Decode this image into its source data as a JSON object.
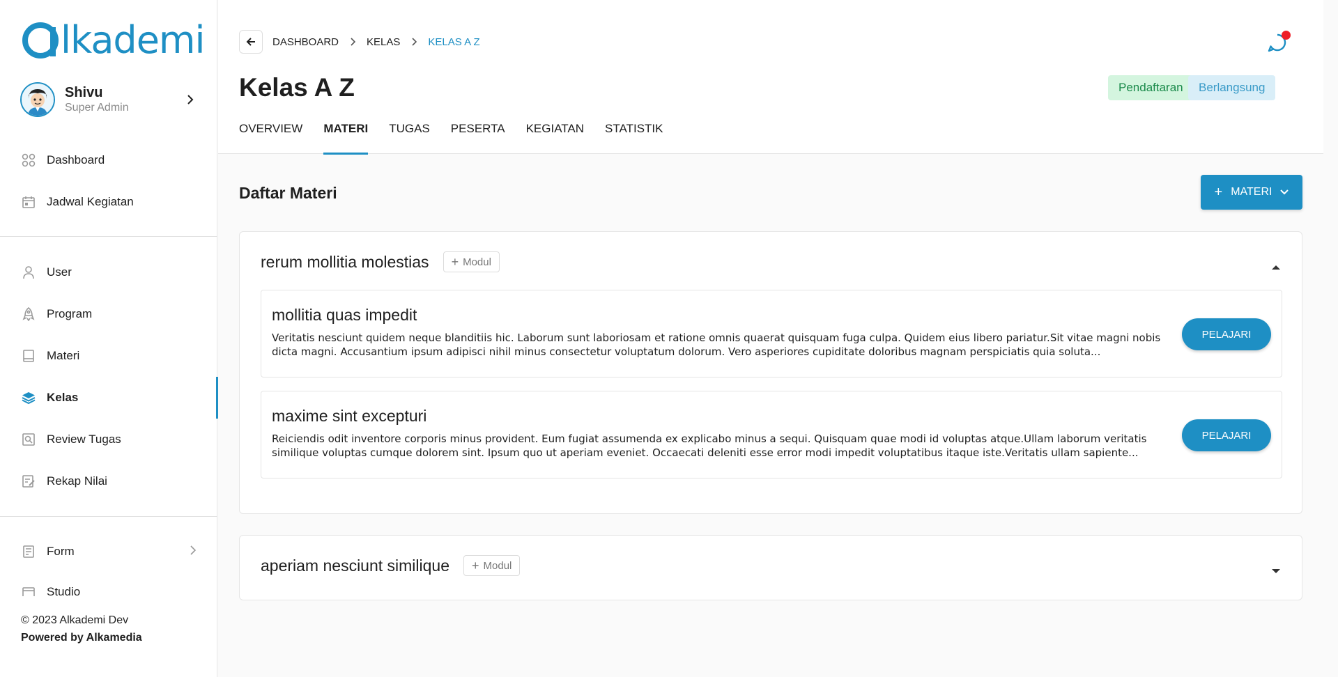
{
  "app": {
    "logo_text": "lkademi",
    "brand_color": "#1e8fc4"
  },
  "user": {
    "name": "Shivu",
    "role": "Super Admin"
  },
  "sidebar": {
    "group1": [
      {
        "label": "Dashboard",
        "icon": "dashboard-icon"
      },
      {
        "label": "Jadwal Kegiatan",
        "icon": "calendar-icon"
      }
    ],
    "group2": [
      {
        "label": "User",
        "icon": "user-icon"
      },
      {
        "label": "Program",
        "icon": "rocket-icon"
      },
      {
        "label": "Materi",
        "icon": "book-icon"
      },
      {
        "label": "Kelas",
        "icon": "layers-icon",
        "active": true
      },
      {
        "label": "Review Tugas",
        "icon": "review-icon"
      },
      {
        "label": "Rekap Nilai",
        "icon": "grade-icon"
      }
    ],
    "group3": [
      {
        "label": "Form",
        "icon": "form-icon"
      },
      {
        "label": "Studio",
        "icon": "studio-icon"
      }
    ]
  },
  "footer": {
    "copyright": "© 2023 Alkademi Dev",
    "powered": "Powered by Alkamedia"
  },
  "breadcrumb": [
    "DASHBOARD",
    "KELAS",
    "KELAS A Z"
  ],
  "page": {
    "title": "Kelas A Z",
    "badges": [
      "Pendaftaran",
      "Berlangsung"
    ]
  },
  "tabs": [
    "OVERVIEW",
    "MATERI",
    "TUGAS",
    "PESERTA",
    "KEGIATAN",
    "STATISTIK"
  ],
  "active_tab": "MATERI",
  "content": {
    "section_title": "Daftar Materi",
    "add_button": "MATERI",
    "modul_button": "Modul",
    "lesson_button": "PELAJARI"
  },
  "modules": [
    {
      "title": "rerum mollitia molestias",
      "expanded": true,
      "lessons": [
        {
          "title": "mollitia quas impedit",
          "desc": "Veritatis nesciunt quidem neque blanditiis hic. Laborum sunt laboriosam et ratione omnis quaerat quisquam fuga culpa. Quidem eius libero pariatur.Sit vitae magni nobis dicta magni. Accusantium ipsum adipisci nihil minus consectetur voluptatum dolorum. Vero asperiores cupiditate doloribus magnam perspiciatis quia soluta..."
        },
        {
          "title": "maxime sint excepturi",
          "desc": "Reiciendis odit inventore corporis minus provident. Eum fugiat assumenda ex explicabo minus a sequi. Quisquam quae modi id voluptas atque.Ullam laborum veritatis similique voluptas cumque dolorem sint. Ipsum quo ut aperiam eveniet. Occaecati deleniti esse error modi impedit voluptatibus itaque iste.Veritatis ullam sapiente..."
        }
      ]
    },
    {
      "title": "aperiam nesciunt similique",
      "expanded": false,
      "lessons": []
    }
  ]
}
